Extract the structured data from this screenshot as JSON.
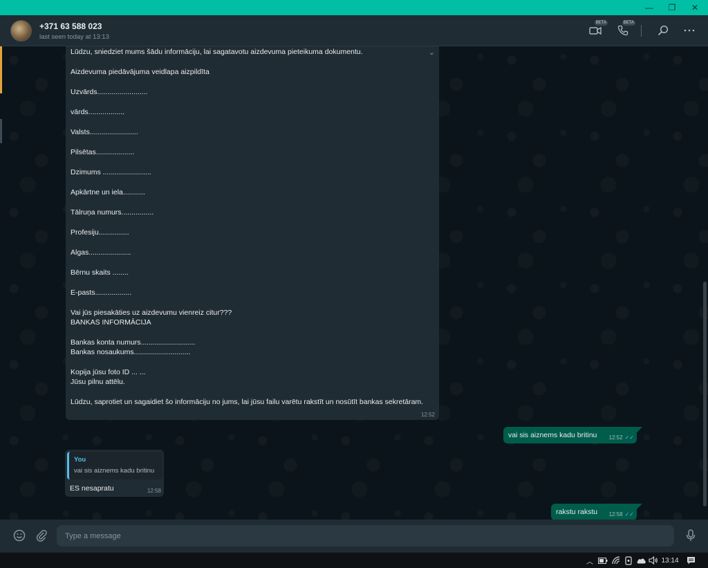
{
  "titlebar": {
    "minimize": "—",
    "restore": "❐",
    "close": "✕"
  },
  "header": {
    "contact_name": "+371 63 588 023",
    "last_seen": "last seen today at 13:13",
    "badges": {
      "video": "BETA",
      "voice": "BETA"
    },
    "icons": [
      "video-call-icon",
      "voice-call-icon",
      "search-icon",
      "menu-icon"
    ]
  },
  "messages": {
    "form": {
      "lines": [
        "Lūdzu, sniedziet mums šādu informāciju, lai sagatavotu aizdevuma pieteikuma dokumentu.",
        "Aizdevuma piedāvājuma veidlapa aizpildīta",
        "Uzvārds.........................",
        "vārds..................",
        "Valsts........................",
        "Pilsētas...................",
        "Dzimums ........................",
        "Apkārtne un iela...........",
        "Tālruņa numurs................",
        "Profesiju...............",
        "Algas.....................",
        "Bērnu skaits ........",
        "E-pasts..................",
        "Vai jūs piesakāties uz aizdevumu vienreiz citur???",
        "BANKAS INFORMĀCIJA",
        "Bankas konta numurs...........................",
        "Bankas nosaukums............................",
        "Kopija jūsu foto ID ... ...",
        "Jūsu pilnu attēlu.",
        "Lūdzu, saprotiet un sagaidiet šo informāciju no jums, lai jūsu failu varētu rakstīt un nosūtīt bankas sekretāram."
      ],
      "time": "12:52"
    },
    "out1": {
      "text": "vai sis aiznems kadu britinu",
      "time": "12:52"
    },
    "reply": {
      "quote_author": "You",
      "quote_text": "vai sis aiznems kadu britinu",
      "text": "ES nesapratu",
      "time": "12:58"
    },
    "out2": {
      "text": "rakstu rakstu",
      "time": "12:58"
    }
  },
  "composer": {
    "placeholder": "Type a message",
    "icons": [
      "emoji-icon",
      "attach-icon",
      "microphone-icon"
    ]
  },
  "taskbar": {
    "time": "13:14"
  }
}
